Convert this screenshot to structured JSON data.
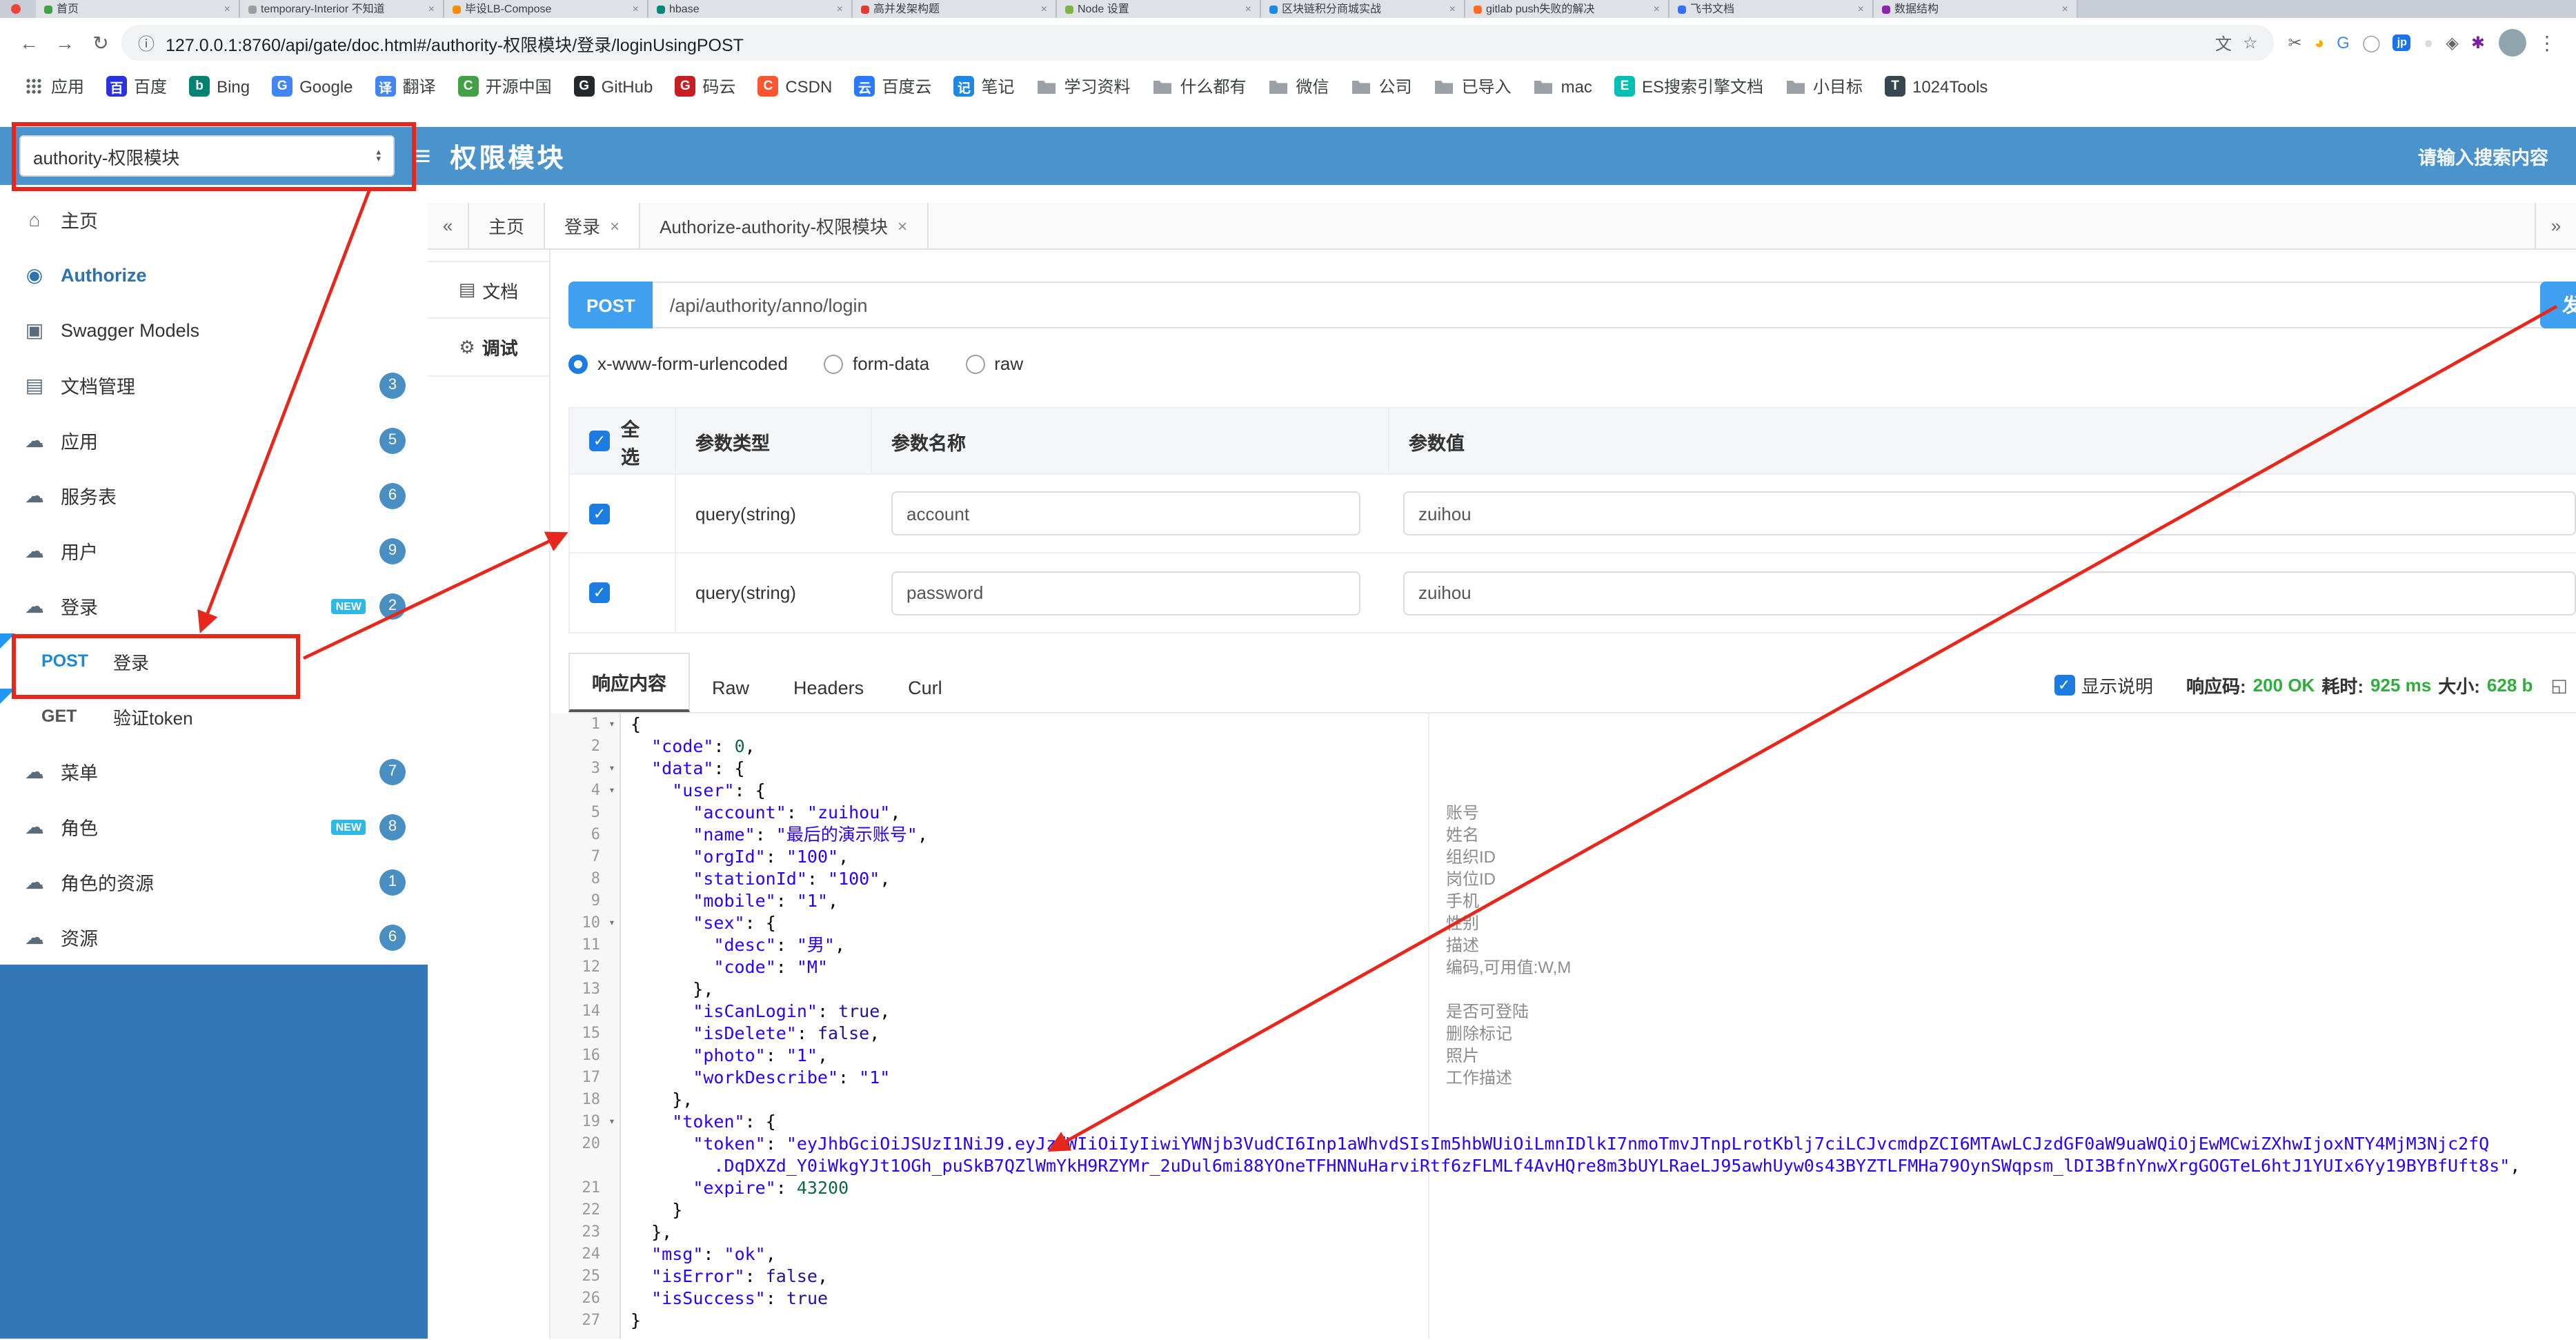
{
  "colors": {
    "header_blue": "#4b93cc",
    "sidebar_fill": "#3277b8",
    "accent": "#3fa0ef",
    "badge_blue": "#4a8fc2",
    "anno_red": "#e8271c",
    "green": "#2fae3e"
  },
  "glyphs": {
    "close": "×",
    "fold": "▾",
    "sel_up": "▴",
    "sel_down": "▾",
    "back": "←",
    "forward": "→",
    "reload": "↻",
    "info": "ⓘ",
    "translate": "文",
    "star": "☆",
    "hamburger": "≡",
    "collapse": "«",
    "expand": "»",
    "resp_expand": "◱",
    "dots": "⋮",
    "home": "⌂",
    "authorize": "◉",
    "models": "▣",
    "page": "▤",
    "cloud": "☁",
    "doc": "▤",
    "debug": "⚙"
  },
  "browser": {
    "url": "127.0.0.1:8760/api/gate/doc.html#/authority-权限模块/登录/loginUsingPOST",
    "tabs": [
      {
        "title": "首页",
        "fav": "#43a047"
      },
      {
        "title": "temporary-Interior 不知道",
        "fav": "#9e9e9e"
      },
      {
        "title": "毕设LB-Compose",
        "fav": "#fb8c00"
      },
      {
        "title": "hbase",
        "fav": "#00897b"
      },
      {
        "title": "高并发架构题",
        "fav": "#e53935"
      },
      {
        "title": "Node 设置",
        "fav": "#7cb342"
      },
      {
        "title": "区块链积分商城实战",
        "fav": "#1e88e5"
      },
      {
        "title": "gitlab push失败的解决",
        "fav": "#fc6d26"
      },
      {
        "title": "飞书文档",
        "fav": "#3370ff"
      },
      {
        "title": "数据结构",
        "fav": "#8e24aa"
      }
    ],
    "ext_icons": [
      {
        "name": "screenshot-icon",
        "glyph": "✂",
        "color": "#5f6368",
        "box": false
      },
      {
        "name": "palette-icon",
        "glyph": "◕",
        "color": "#f9ab00",
        "box": false
      },
      {
        "name": "google-icon",
        "glyph": "G",
        "color": "#4285F4",
        "box": false
      },
      {
        "name": "ring-icon",
        "glyph": "◯",
        "color": "#9aa0a6",
        "box": false
      },
      {
        "name": "jp-badge-icon",
        "glyph": "jp",
        "color": "#1a73e8",
        "box": true
      },
      {
        "name": "dot-icon",
        "glyph": "●",
        "color": "#dadce0",
        "box": false
      },
      {
        "name": "shield-icon",
        "glyph": "◈",
        "color": "#5f6368",
        "box": false
      },
      {
        "name": "pinwheel-icon",
        "glyph": "✱",
        "color": "#7b1fa2",
        "box": false
      }
    ],
    "bookmarks": [
      {
        "label": "应用",
        "type": "apps"
      },
      {
        "label": "百度",
        "letter": "百",
        "color": "#2932E1"
      },
      {
        "label": "Bing",
        "letter": "b",
        "color": "#008373"
      },
      {
        "label": "Google",
        "letter": "G",
        "color": "#4285F4"
      },
      {
        "label": "翻译",
        "letter": "译",
        "color": "#4285F4"
      },
      {
        "label": "开源中国",
        "letter": "C",
        "color": "#43a047"
      },
      {
        "label": "GitHub",
        "letter": "G",
        "color": "#24292e"
      },
      {
        "label": "码云",
        "letter": "G",
        "color": "#c71d23"
      },
      {
        "label": "CSDN",
        "letter": "C",
        "color": "#fc5531"
      },
      {
        "label": "百度云",
        "letter": "云",
        "color": "#2979ff"
      },
      {
        "label": "笔记",
        "letter": "记",
        "color": "#1e88e5"
      },
      {
        "label": "学习资料",
        "type": "folder"
      },
      {
        "label": "什么都有",
        "type": "folder"
      },
      {
        "label": "微信",
        "type": "folder"
      },
      {
        "label": "公司",
        "type": "folder"
      },
      {
        "label": "已导入",
        "type": "folder"
      },
      {
        "label": "mac",
        "type": "folder"
      },
      {
        "label": "ES搜索引擎文档",
        "letter": "E",
        "color": "#00bfb3"
      },
      {
        "label": "小目标",
        "type": "folder"
      },
      {
        "label": "1024Tools",
        "letter": "T",
        "color": "#37474f"
      }
    ]
  },
  "header": {
    "module_select": "authority-权限模块",
    "title": "权限模块",
    "search_placeholder": "请输入搜索内容"
  },
  "sidebar": {
    "items": [
      {
        "label": "主页",
        "icon": "home"
      },
      {
        "label": "Authorize",
        "icon": "authorize",
        "bold": true,
        "color": "#2d71ad"
      },
      {
        "label": "Swagger Models",
        "icon": "models"
      },
      {
        "label": "文档管理",
        "icon": "page",
        "badge": "3"
      },
      {
        "label": "应用",
        "icon": "cloud",
        "badge": "5"
      },
      {
        "label": "服务表",
        "icon": "cloud",
        "badge": "6"
      },
      {
        "label": "用户",
        "icon": "cloud",
        "badge": "9"
      },
      {
        "label": "登录",
        "icon": "cloud",
        "badge": "2",
        "new": true
      },
      {
        "method": "POST",
        "label": "登录",
        "method_color": "#1e88d4"
      },
      {
        "method": "GET",
        "label": "验证token",
        "method_color": "#555555"
      },
      {
        "label": "菜单",
        "icon": "cloud",
        "badge": "7"
      },
      {
        "label": "角色",
        "icon": "cloud",
        "badge": "8",
        "new": true
      },
      {
        "label": "角色的资源",
        "icon": "cloud",
        "badge": "1"
      },
      {
        "label": "资源",
        "icon": "cloud",
        "badge": "6"
      }
    ]
  },
  "tabs_bar": {
    "items": [
      {
        "label": "主页",
        "closable": false,
        "active": false
      },
      {
        "label": "登录",
        "closable": true,
        "active": true
      },
      {
        "label": "Authorize-authority-权限模块",
        "closable": true,
        "active": false
      }
    ]
  },
  "doc_tabs": {
    "doc": "文档",
    "debug": "调试"
  },
  "request": {
    "method": "POST",
    "path": "/api/authority/anno/login",
    "send_label": "发",
    "content_types": [
      "x-www-form-urlencoded",
      "form-data",
      "raw"
    ],
    "selected_index": 0
  },
  "params_table": {
    "select_all": "全选",
    "headers": [
      "参数类型",
      "参数名称",
      "参数值"
    ],
    "rows": [
      {
        "checked": true,
        "type": "query(string)",
        "name": "account",
        "value": "zuihou"
      },
      {
        "checked": true,
        "type": "query(string)",
        "name": "password",
        "value": "zuihou"
      }
    ]
  },
  "response": {
    "tabs": [
      "响应内容",
      "Raw",
      "Headers",
      "Curl"
    ],
    "active_index": 0,
    "show_desc_label": "显示说明",
    "meta": {
      "code_label": "响应码:",
      "code": "200 OK",
      "time_label": "耗时:",
      "time": "925 ms",
      "size_label": "大小:",
      "size": "628 b"
    }
  },
  "editor": {
    "lines": [
      {
        "n": "1",
        "fold": true,
        "seg": [
          [
            "p",
            "{"
          ]
        ]
      },
      {
        "n": "2",
        "seg": [
          [
            "p",
            "  "
          ],
          [
            "s",
            "\"code\""
          ],
          [
            "p",
            ": "
          ],
          [
            "n",
            "0"
          ],
          [
            "p",
            ","
          ]
        ]
      },
      {
        "n": "3",
        "fold": true,
        "seg": [
          [
            "p",
            "  "
          ],
          [
            "s",
            "\"data\""
          ],
          [
            "p",
            ": {"
          ]
        ]
      },
      {
        "n": "4",
        "fold": true,
        "seg": [
          [
            "p",
            "    "
          ],
          [
            "s",
            "\"user\""
          ],
          [
            "p",
            ": {"
          ]
        ]
      },
      {
        "n": "5",
        "c": "账号",
        "seg": [
          [
            "p",
            "      "
          ],
          [
            "s",
            "\"account\""
          ],
          [
            "p",
            ": "
          ],
          [
            "s",
            "\"zuihou\""
          ],
          [
            "p",
            ","
          ]
        ]
      },
      {
        "n": "6",
        "c": "姓名",
        "seg": [
          [
            "p",
            "      "
          ],
          [
            "s",
            "\"name\""
          ],
          [
            "p",
            ": "
          ],
          [
            "s",
            "\"最后的演示账号\""
          ],
          [
            "p",
            ","
          ]
        ]
      },
      {
        "n": "7",
        "c": "组织ID",
        "seg": [
          [
            "p",
            "      "
          ],
          [
            "s",
            "\"orgId\""
          ],
          [
            "p",
            ": "
          ],
          [
            "s",
            "\"100\""
          ],
          [
            "p",
            ","
          ]
        ]
      },
      {
        "n": "8",
        "c": "岗位ID",
        "seg": [
          [
            "p",
            "      "
          ],
          [
            "s",
            "\"stationId\""
          ],
          [
            "p",
            ": "
          ],
          [
            "s",
            "\"100\""
          ],
          [
            "p",
            ","
          ]
        ]
      },
      {
        "n": "9",
        "c": "手机",
        "seg": [
          [
            "p",
            "      "
          ],
          [
            "s",
            "\"mobile\""
          ],
          [
            "p",
            ": "
          ],
          [
            "s",
            "\"1\""
          ],
          [
            "p",
            ","
          ]
        ]
      },
      {
        "n": "10",
        "fold": true,
        "c": "性别",
        "seg": [
          [
            "p",
            "      "
          ],
          [
            "s",
            "\"sex\""
          ],
          [
            "p",
            ": {"
          ]
        ]
      },
      {
        "n": "11",
        "c": "描述",
        "seg": [
          [
            "p",
            "        "
          ],
          [
            "s",
            "\"desc\""
          ],
          [
            "p",
            ": "
          ],
          [
            "s",
            "\"男\""
          ],
          [
            "p",
            ","
          ]
        ]
      },
      {
        "n": "12",
        "c": "编码,可用值:W,M",
        "seg": [
          [
            "p",
            "        "
          ],
          [
            "s",
            "\"code\""
          ],
          [
            "p",
            ": "
          ],
          [
            "s",
            "\"M\""
          ]
        ]
      },
      {
        "n": "13",
        "seg": [
          [
            "p",
            "      },"
          ]
        ]
      },
      {
        "n": "14",
        "c": "是否可登陆",
        "seg": [
          [
            "p",
            "      "
          ],
          [
            "s",
            "\"isCanLogin\""
          ],
          [
            "p",
            ": "
          ],
          [
            "b",
            "true"
          ],
          [
            "p",
            ","
          ]
        ]
      },
      {
        "n": "15",
        "c": "删除标记",
        "seg": [
          [
            "p",
            "      "
          ],
          [
            "s",
            "\"isDelete\""
          ],
          [
            "p",
            ": "
          ],
          [
            "b",
            "false"
          ],
          [
            "p",
            ","
          ]
        ]
      },
      {
        "n": "16",
        "c": "照片",
        "seg": [
          [
            "p",
            "      "
          ],
          [
            "s",
            "\"photo\""
          ],
          [
            "p",
            ": "
          ],
          [
            "s",
            "\"1\""
          ],
          [
            "p",
            ","
          ]
        ]
      },
      {
        "n": "17",
        "c": "工作描述",
        "seg": [
          [
            "p",
            "      "
          ],
          [
            "s",
            "\"workDescribe\""
          ],
          [
            "p",
            ": "
          ],
          [
            "s",
            "\"1\""
          ]
        ]
      },
      {
        "n": "18",
        "seg": [
          [
            "p",
            "    },"
          ]
        ]
      },
      {
        "n": "19",
        "fold": true,
        "seg": [
          [
            "p",
            "    "
          ],
          [
            "s",
            "\"token\""
          ],
          [
            "p",
            ": {"
          ]
        ]
      },
      {
        "n": "20",
        "seg": [
          [
            "p",
            "      "
          ],
          [
            "s",
            "\"token\""
          ],
          [
            "p",
            ": "
          ],
          [
            "s",
            "\"eyJhbGciOiJSUzI1NiJ9.eyJzdWIiOiIyIiwiYWNjb3VudCI6Inp1aWhvdSIsIm5hbWUiOiLmnIDlkI7nmoTmvJTnpLrotKblj7ciLCJvcmdpZCI6MTAwLCJzdGF0aW9uaWQiOjEwMCwiZXhwIjoxNTY4MjM3Njc2fQ"
          ]
        ]
      },
      {
        "n": "",
        "seg": [
          [
            "s",
            "        .DqDXZd_Y0iWkgYJt1OGh_puSkB7QZlWmYkH9RZYMr_2uDul6mi88YOneTFHNNuHarviRtf6zFLMLf4AvHQre8m3bUYLRaeLJ95awhUyw0s43BYZTLFMHa79OynSWqpsm_lDI3BfnYnwXrgGOGTeL6htJ1YUIx6Yy19BYBfUft8s\""
          ],
          [
            "p",
            ","
          ]
        ]
      },
      {
        "n": "21",
        "seg": [
          [
            "p",
            "      "
          ],
          [
            "s",
            "\"expire\""
          ],
          [
            "p",
            ": "
          ],
          [
            "n",
            "43200"
          ]
        ]
      },
      {
        "n": "22",
        "seg": [
          [
            "p",
            "    }"
          ]
        ]
      },
      {
        "n": "23",
        "seg": [
          [
            "p",
            "  },"
          ]
        ]
      },
      {
        "n": "24",
        "seg": [
          [
            "p",
            "  "
          ],
          [
            "s",
            "\"msg\""
          ],
          [
            "p",
            ": "
          ],
          [
            "s",
            "\"ok\""
          ],
          [
            "p",
            ","
          ]
        ]
      },
      {
        "n": "25",
        "seg": [
          [
            "p",
            "  "
          ],
          [
            "s",
            "\"isError\""
          ],
          [
            "p",
            ": "
          ],
          [
            "b",
            "false"
          ],
          [
            "p",
            ","
          ]
        ]
      },
      {
        "n": "26",
        "seg": [
          [
            "p",
            "  "
          ],
          [
            "s",
            "\"isSuccess\""
          ],
          [
            "p",
            ": "
          ],
          [
            "b",
            "true"
          ]
        ]
      },
      {
        "n": "27",
        "seg": [
          [
            "p",
            "}"
          ]
        ]
      }
    ]
  }
}
